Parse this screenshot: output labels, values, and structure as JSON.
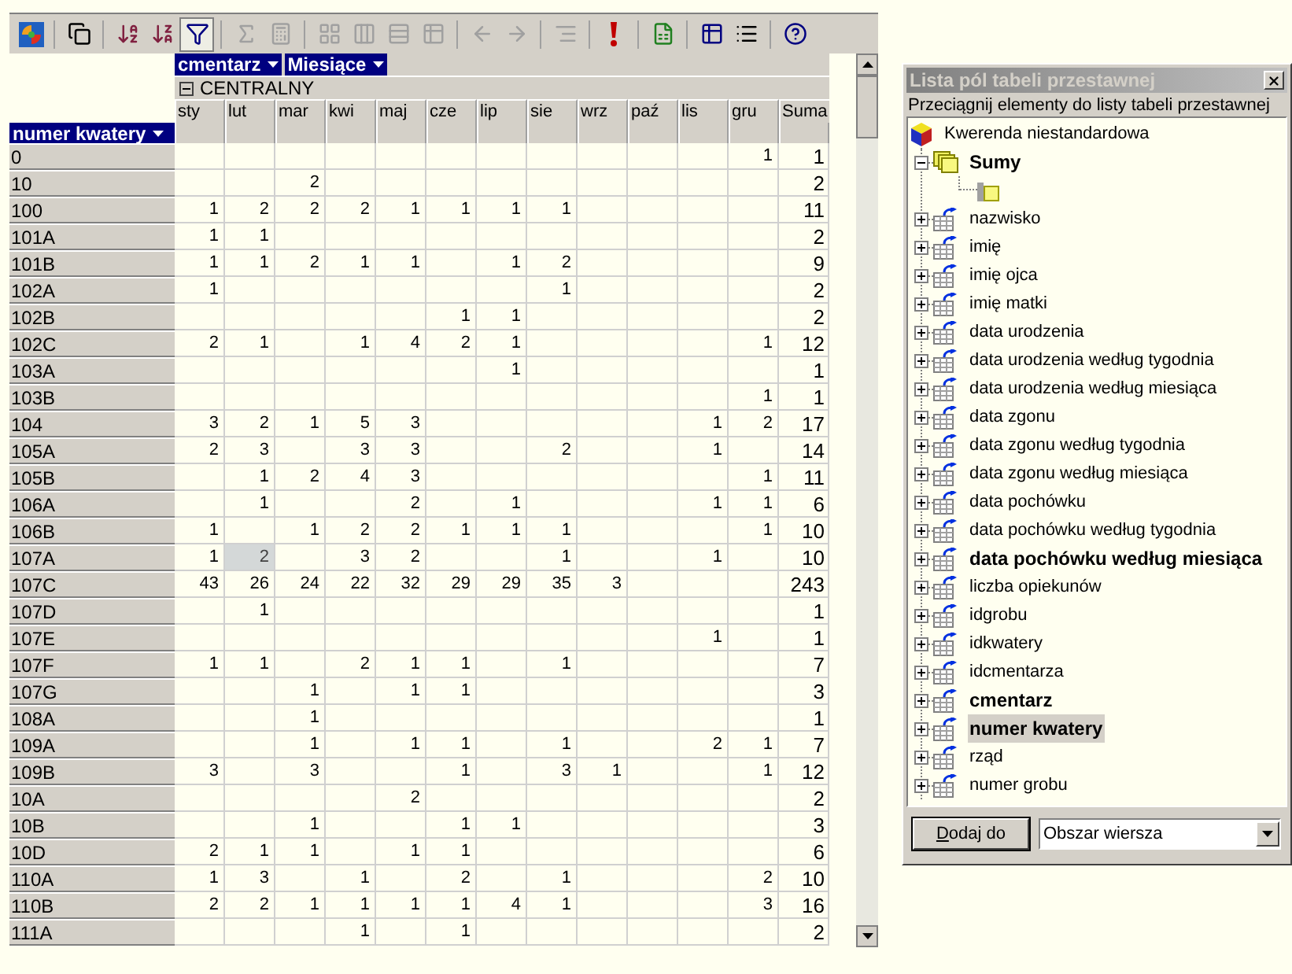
{
  "pivot": {
    "column_fields": [
      {
        "label": "cmentarz"
      },
      {
        "label": "Miesiące"
      }
    ],
    "group": {
      "label": "CENTRALNY",
      "expanded": true
    },
    "columns": [
      "sty",
      "lut",
      "mar",
      "kwi",
      "maj",
      "cze",
      "lip",
      "sie",
      "wrz",
      "paź",
      "lis",
      "gru"
    ],
    "total_label": "Suma",
    "row_field": {
      "label": "numer kwatery"
    },
    "rows": [
      {
        "label": "0",
        "cells": [
          null,
          null,
          null,
          null,
          null,
          null,
          null,
          null,
          null,
          null,
          null,
          {
            "value": "1",
            "selected": false
          }
        ],
        "total": "1"
      },
      {
        "label": "10",
        "cells": [
          null,
          null,
          {
            "value": "2",
            "selected": false
          },
          null,
          null,
          null,
          null,
          null,
          null,
          null,
          null,
          null
        ],
        "total": "2"
      },
      {
        "label": "100",
        "cells": [
          {
            "value": "1",
            "selected": false
          },
          {
            "value": "2",
            "selected": false
          },
          {
            "value": "2",
            "selected": false
          },
          {
            "value": "2",
            "selected": false
          },
          {
            "value": "1",
            "selected": false
          },
          {
            "value": "1",
            "selected": false
          },
          {
            "value": "1",
            "selected": false
          },
          {
            "value": "1",
            "selected": false
          },
          null,
          null,
          null,
          null
        ],
        "total": "11"
      },
      {
        "label": "101A",
        "cells": [
          {
            "value": "1",
            "selected": false
          },
          {
            "value": "1",
            "selected": false
          },
          null,
          null,
          null,
          null,
          null,
          null,
          null,
          null,
          null,
          null
        ],
        "total": "2"
      },
      {
        "label": "101B",
        "cells": [
          {
            "value": "1",
            "selected": false
          },
          {
            "value": "1",
            "selected": false
          },
          {
            "value": "2",
            "selected": false
          },
          {
            "value": "1",
            "selected": false
          },
          {
            "value": "1",
            "selected": false
          },
          null,
          {
            "value": "1",
            "selected": false
          },
          {
            "value": "2",
            "selected": false
          },
          null,
          null,
          null,
          null
        ],
        "total": "9"
      },
      {
        "label": "102A",
        "cells": [
          {
            "value": "1",
            "selected": false
          },
          null,
          null,
          null,
          null,
          null,
          null,
          {
            "value": "1",
            "selected": false
          },
          null,
          null,
          null,
          null
        ],
        "total": "2"
      },
      {
        "label": "102B",
        "cells": [
          null,
          null,
          null,
          null,
          null,
          {
            "value": "1",
            "selected": false
          },
          {
            "value": "1",
            "selected": false
          },
          null,
          null,
          null,
          null,
          null
        ],
        "total": "2"
      },
      {
        "label": "102C",
        "cells": [
          {
            "value": "2",
            "selected": false
          },
          {
            "value": "1",
            "selected": false
          },
          null,
          {
            "value": "1",
            "selected": false
          },
          {
            "value": "4",
            "selected": false
          },
          {
            "value": "2",
            "selected": false
          },
          {
            "value": "1",
            "selected": false
          },
          null,
          null,
          null,
          null,
          {
            "value": "1",
            "selected": false
          }
        ],
        "total": "12"
      },
      {
        "label": "103A",
        "cells": [
          null,
          null,
          null,
          null,
          null,
          null,
          {
            "value": "1",
            "selected": false
          },
          null,
          null,
          null,
          null,
          null
        ],
        "total": "1"
      },
      {
        "label": "103B",
        "cells": [
          null,
          null,
          null,
          null,
          null,
          null,
          null,
          null,
          null,
          null,
          null,
          {
            "value": "1",
            "selected": false
          }
        ],
        "total": "1"
      },
      {
        "label": "104",
        "cells": [
          {
            "value": "3",
            "selected": false
          },
          {
            "value": "2",
            "selected": false
          },
          {
            "value": "1",
            "selected": false
          },
          {
            "value": "5",
            "selected": false
          },
          {
            "value": "3",
            "selected": false
          },
          null,
          null,
          null,
          null,
          null,
          {
            "value": "1",
            "selected": false
          },
          {
            "value": "2",
            "selected": false
          }
        ],
        "total": "17"
      },
      {
        "label": "105A",
        "cells": [
          {
            "value": "2",
            "selected": false
          },
          {
            "value": "3",
            "selected": false
          },
          null,
          {
            "value": "3",
            "selected": false
          },
          {
            "value": "3",
            "selected": false
          },
          null,
          null,
          {
            "value": "2",
            "selected": false
          },
          null,
          null,
          {
            "value": "1",
            "selected": false
          },
          null
        ],
        "total": "14"
      },
      {
        "label": "105B",
        "cells": [
          null,
          {
            "value": "1",
            "selected": false
          },
          {
            "value": "2",
            "selected": false
          },
          {
            "value": "4",
            "selected": false
          },
          {
            "value": "3",
            "selected": false
          },
          null,
          null,
          null,
          null,
          null,
          null,
          {
            "value": "1",
            "selected": false
          }
        ],
        "total": "11"
      },
      {
        "label": "106A",
        "cells": [
          null,
          {
            "value": "1",
            "selected": false
          },
          null,
          null,
          {
            "value": "2",
            "selected": false
          },
          null,
          {
            "value": "1",
            "selected": false
          },
          null,
          null,
          null,
          {
            "value": "1",
            "selected": false
          },
          {
            "value": "1",
            "selected": false
          }
        ],
        "total": "6"
      },
      {
        "label": "106B",
        "cells": [
          {
            "value": "1",
            "selected": false
          },
          null,
          {
            "value": "1",
            "selected": false
          },
          {
            "value": "2",
            "selected": false
          },
          {
            "value": "2",
            "selected": false
          },
          {
            "value": "1",
            "selected": false
          },
          {
            "value": "1",
            "selected": false
          },
          {
            "value": "1",
            "selected": false
          },
          null,
          null,
          null,
          {
            "value": "1",
            "selected": false
          }
        ],
        "total": "10"
      },
      {
        "label": "107A",
        "cells": [
          {
            "value": "1",
            "selected": false
          },
          {
            "value": "2",
            "selected": true
          },
          null,
          {
            "value": "3",
            "selected": false
          },
          {
            "value": "2",
            "selected": false
          },
          null,
          null,
          {
            "value": "1",
            "selected": false
          },
          null,
          null,
          {
            "value": "1",
            "selected": false
          },
          null
        ],
        "total": "10"
      },
      {
        "label": "107C",
        "cells": [
          {
            "value": "43",
            "selected": false
          },
          {
            "value": "26",
            "selected": false
          },
          {
            "value": "24",
            "selected": false
          },
          {
            "value": "22",
            "selected": false
          },
          {
            "value": "32",
            "selected": false
          },
          {
            "value": "29",
            "selected": false
          },
          {
            "value": "29",
            "selected": false
          },
          {
            "value": "35",
            "selected": false
          },
          {
            "value": "3",
            "selected": false
          },
          null,
          null,
          null
        ],
        "total": "243"
      },
      {
        "label": "107D",
        "cells": [
          null,
          {
            "value": "1",
            "selected": false
          },
          null,
          null,
          null,
          null,
          null,
          null,
          null,
          null,
          null,
          null
        ],
        "total": "1"
      },
      {
        "label": "107E",
        "cells": [
          null,
          null,
          null,
          null,
          null,
          null,
          null,
          null,
          null,
          null,
          {
            "value": "1",
            "selected": false
          },
          null
        ],
        "total": "1"
      },
      {
        "label": "107F",
        "cells": [
          {
            "value": "1",
            "selected": false
          },
          {
            "value": "1",
            "selected": false
          },
          null,
          {
            "value": "2",
            "selected": false
          },
          {
            "value": "1",
            "selected": false
          },
          {
            "value": "1",
            "selected": false
          },
          null,
          {
            "value": "1",
            "selected": false
          },
          null,
          null,
          null,
          null
        ],
        "total": "7"
      },
      {
        "label": "107G",
        "cells": [
          null,
          null,
          {
            "value": "1",
            "selected": false
          },
          null,
          {
            "value": "1",
            "selected": false
          },
          {
            "value": "1",
            "selected": false
          },
          null,
          null,
          null,
          null,
          null,
          null
        ],
        "total": "3"
      },
      {
        "label": "108A",
        "cells": [
          null,
          null,
          {
            "value": "1",
            "selected": false
          },
          null,
          null,
          null,
          null,
          null,
          null,
          null,
          null,
          null
        ],
        "total": "1"
      },
      {
        "label": "109A",
        "cells": [
          null,
          null,
          {
            "value": "1",
            "selected": false
          },
          null,
          {
            "value": "1",
            "selected": false
          },
          {
            "value": "1",
            "selected": false
          },
          null,
          {
            "value": "1",
            "selected": false
          },
          null,
          null,
          {
            "value": "2",
            "selected": false
          },
          {
            "value": "1",
            "selected": false
          }
        ],
        "total": "7"
      },
      {
        "label": "109B",
        "cells": [
          {
            "value": "3",
            "selected": false
          },
          null,
          {
            "value": "3",
            "selected": false
          },
          null,
          null,
          {
            "value": "1",
            "selected": false
          },
          null,
          {
            "value": "3",
            "selected": false
          },
          {
            "value": "1",
            "selected": false
          },
          null,
          null,
          {
            "value": "1",
            "selected": false
          }
        ],
        "total": "12"
      },
      {
        "label": "10A",
        "cells": [
          null,
          null,
          null,
          null,
          {
            "value": "2",
            "selected": false
          },
          null,
          null,
          null,
          null,
          null,
          null,
          null
        ],
        "total": "2"
      },
      {
        "label": "10B",
        "cells": [
          null,
          null,
          {
            "value": "1",
            "selected": false
          },
          null,
          null,
          {
            "value": "1",
            "selected": false
          },
          {
            "value": "1",
            "selected": false
          },
          null,
          null,
          null,
          null,
          null
        ],
        "total": "3"
      },
      {
        "label": "10D",
        "cells": [
          {
            "value": "2",
            "selected": false
          },
          {
            "value": "1",
            "selected": false
          },
          {
            "value": "1",
            "selected": false
          },
          null,
          {
            "value": "1",
            "selected": false
          },
          {
            "value": "1",
            "selected": false
          },
          null,
          null,
          null,
          null,
          null,
          null
        ],
        "total": "6"
      },
      {
        "label": "110A",
        "cells": [
          {
            "value": "1",
            "selected": false
          },
          {
            "value": "3",
            "selected": false
          },
          null,
          {
            "value": "1",
            "selected": false
          },
          null,
          {
            "value": "2",
            "selected": false
          },
          null,
          {
            "value": "1",
            "selected": false
          },
          null,
          null,
          null,
          {
            "value": "2",
            "selected": false
          }
        ],
        "total": "10"
      },
      {
        "label": "110B",
        "cells": [
          {
            "value": "2",
            "selected": false
          },
          {
            "value": "2",
            "selected": false
          },
          {
            "value": "1",
            "selected": false
          },
          {
            "value": "1",
            "selected": false
          },
          {
            "value": "1",
            "selected": false
          },
          {
            "value": "1",
            "selected": false
          },
          {
            "value": "4",
            "selected": false
          },
          {
            "value": "1",
            "selected": false
          },
          null,
          null,
          null,
          {
            "value": "3",
            "selected": false
          }
        ],
        "total": "16"
      },
      {
        "label": "111A",
        "cells": [
          null,
          null,
          null,
          {
            "value": "1",
            "selected": false
          },
          null,
          {
            "value": "1",
            "selected": false
          },
          null,
          null,
          null,
          null,
          null,
          null
        ],
        "total": "2"
      }
    ]
  },
  "field_list": {
    "title": "Lista pól tabeli przestawnej",
    "hint": "Przeciągnij elementy do listy tabeli przestawnej",
    "tree": {
      "label": "Kwerenda niestandardowa",
      "kind": "cube",
      "children": [
        {
          "label": "Sumy",
          "kind": "measures",
          "expanded": true,
          "in_use": true,
          "selected": false,
          "children": [
            {
              "kind": "measure"
            }
          ]
        },
        {
          "label": "nazwisko",
          "kind": "field",
          "expanded": false,
          "in_use": false,
          "selected": false
        },
        {
          "label": "imię",
          "kind": "field",
          "expanded": false,
          "in_use": false,
          "selected": false
        },
        {
          "label": "imię ojca",
          "kind": "field",
          "expanded": false,
          "in_use": false,
          "selected": false
        },
        {
          "label": "imię matki",
          "kind": "field",
          "expanded": false,
          "in_use": false,
          "selected": false
        },
        {
          "label": "data urodzenia",
          "kind": "field",
          "expanded": false,
          "in_use": false,
          "selected": false
        },
        {
          "label": "data urodzenia według tygodnia",
          "kind": "field",
          "expanded": false,
          "in_use": false,
          "selected": false
        },
        {
          "label": "data urodzenia według miesiąca",
          "kind": "field",
          "expanded": false,
          "in_use": false,
          "selected": false
        },
        {
          "label": "data zgonu",
          "kind": "field",
          "expanded": false,
          "in_use": false,
          "selected": false
        },
        {
          "label": "data zgonu według tygodnia",
          "kind": "field",
          "expanded": false,
          "in_use": false,
          "selected": false
        },
        {
          "label": "data zgonu według miesiąca",
          "kind": "field",
          "expanded": false,
          "in_use": false,
          "selected": false
        },
        {
          "label": "data pochówku",
          "kind": "field",
          "expanded": false,
          "in_use": false,
          "selected": false
        },
        {
          "label": "data pochówku według tygodnia",
          "kind": "field",
          "expanded": false,
          "in_use": false,
          "selected": false
        },
        {
          "label": "data pochówku według miesiąca",
          "kind": "field",
          "expanded": false,
          "in_use": true,
          "selected": false
        },
        {
          "label": "liczba opiekunów",
          "kind": "field",
          "expanded": false,
          "in_use": false,
          "selected": false
        },
        {
          "label": "idgrobu",
          "kind": "field",
          "expanded": false,
          "in_use": false,
          "selected": false
        },
        {
          "label": "idkwatery",
          "kind": "field",
          "expanded": false,
          "in_use": false,
          "selected": false
        },
        {
          "label": "idcmentarza",
          "kind": "field",
          "expanded": false,
          "in_use": false,
          "selected": false
        },
        {
          "label": "cmentarz",
          "kind": "field",
          "expanded": false,
          "in_use": true,
          "selected": false
        },
        {
          "label": "numer kwatery",
          "kind": "field",
          "expanded": false,
          "in_use": true,
          "selected": true
        },
        {
          "label": "rząd",
          "kind": "field",
          "expanded": false,
          "in_use": false,
          "selected": false
        },
        {
          "label": "numer grobu",
          "kind": "field",
          "expanded": false,
          "in_use": false,
          "selected": false
        }
      ]
    },
    "add_button": {
      "label": "Dodaj do"
    },
    "target": {
      "value": "Obszar wiersza"
    }
  }
}
